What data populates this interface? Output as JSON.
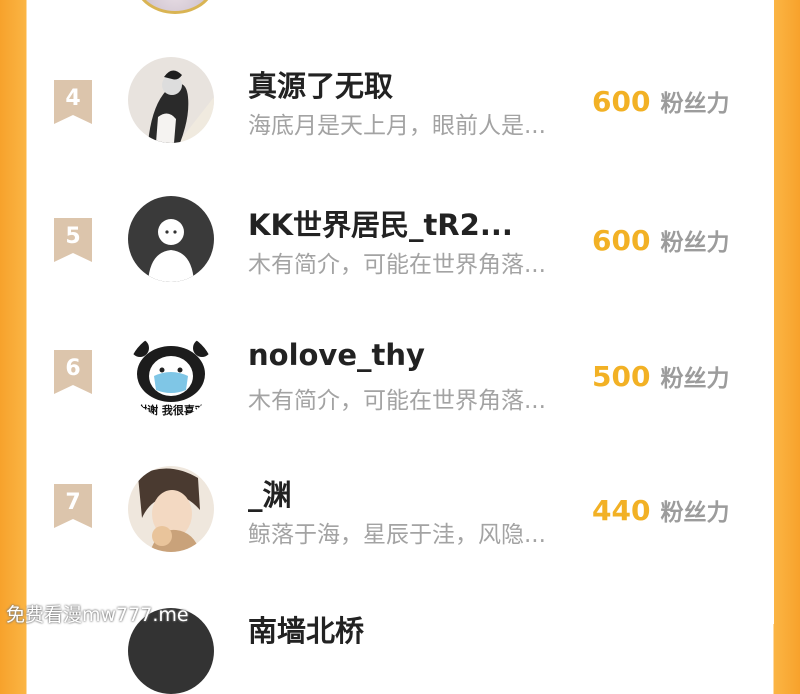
{
  "fans_unit": "粉丝力",
  "rows": [
    {
      "rank": "4",
      "name": "真源了无取",
      "desc": "海底月是天上月，眼前人是...",
      "fans": "600"
    },
    {
      "rank": "5",
      "name": "KK世界居民_tR2...",
      "desc": "木有简介，可能在世界角落...",
      "fans": "600"
    },
    {
      "rank": "6",
      "name": "nolove_thy",
      "desc": "木有简介，可能在世界角落...",
      "fans": "500",
      "avatar_caption": "谢谢 我很喜欢"
    },
    {
      "rank": "7",
      "name": "_渊",
      "desc": "鲸落于海，星辰于洼，风隐...",
      "fans": "440"
    }
  ],
  "partial_row_name": "南墙北桥",
  "watermark": "免费看漫mw777.me",
  "colors": {
    "accent": "#f2b125",
    "badge": "#dcc5ac",
    "frame": "#f7a22c"
  }
}
